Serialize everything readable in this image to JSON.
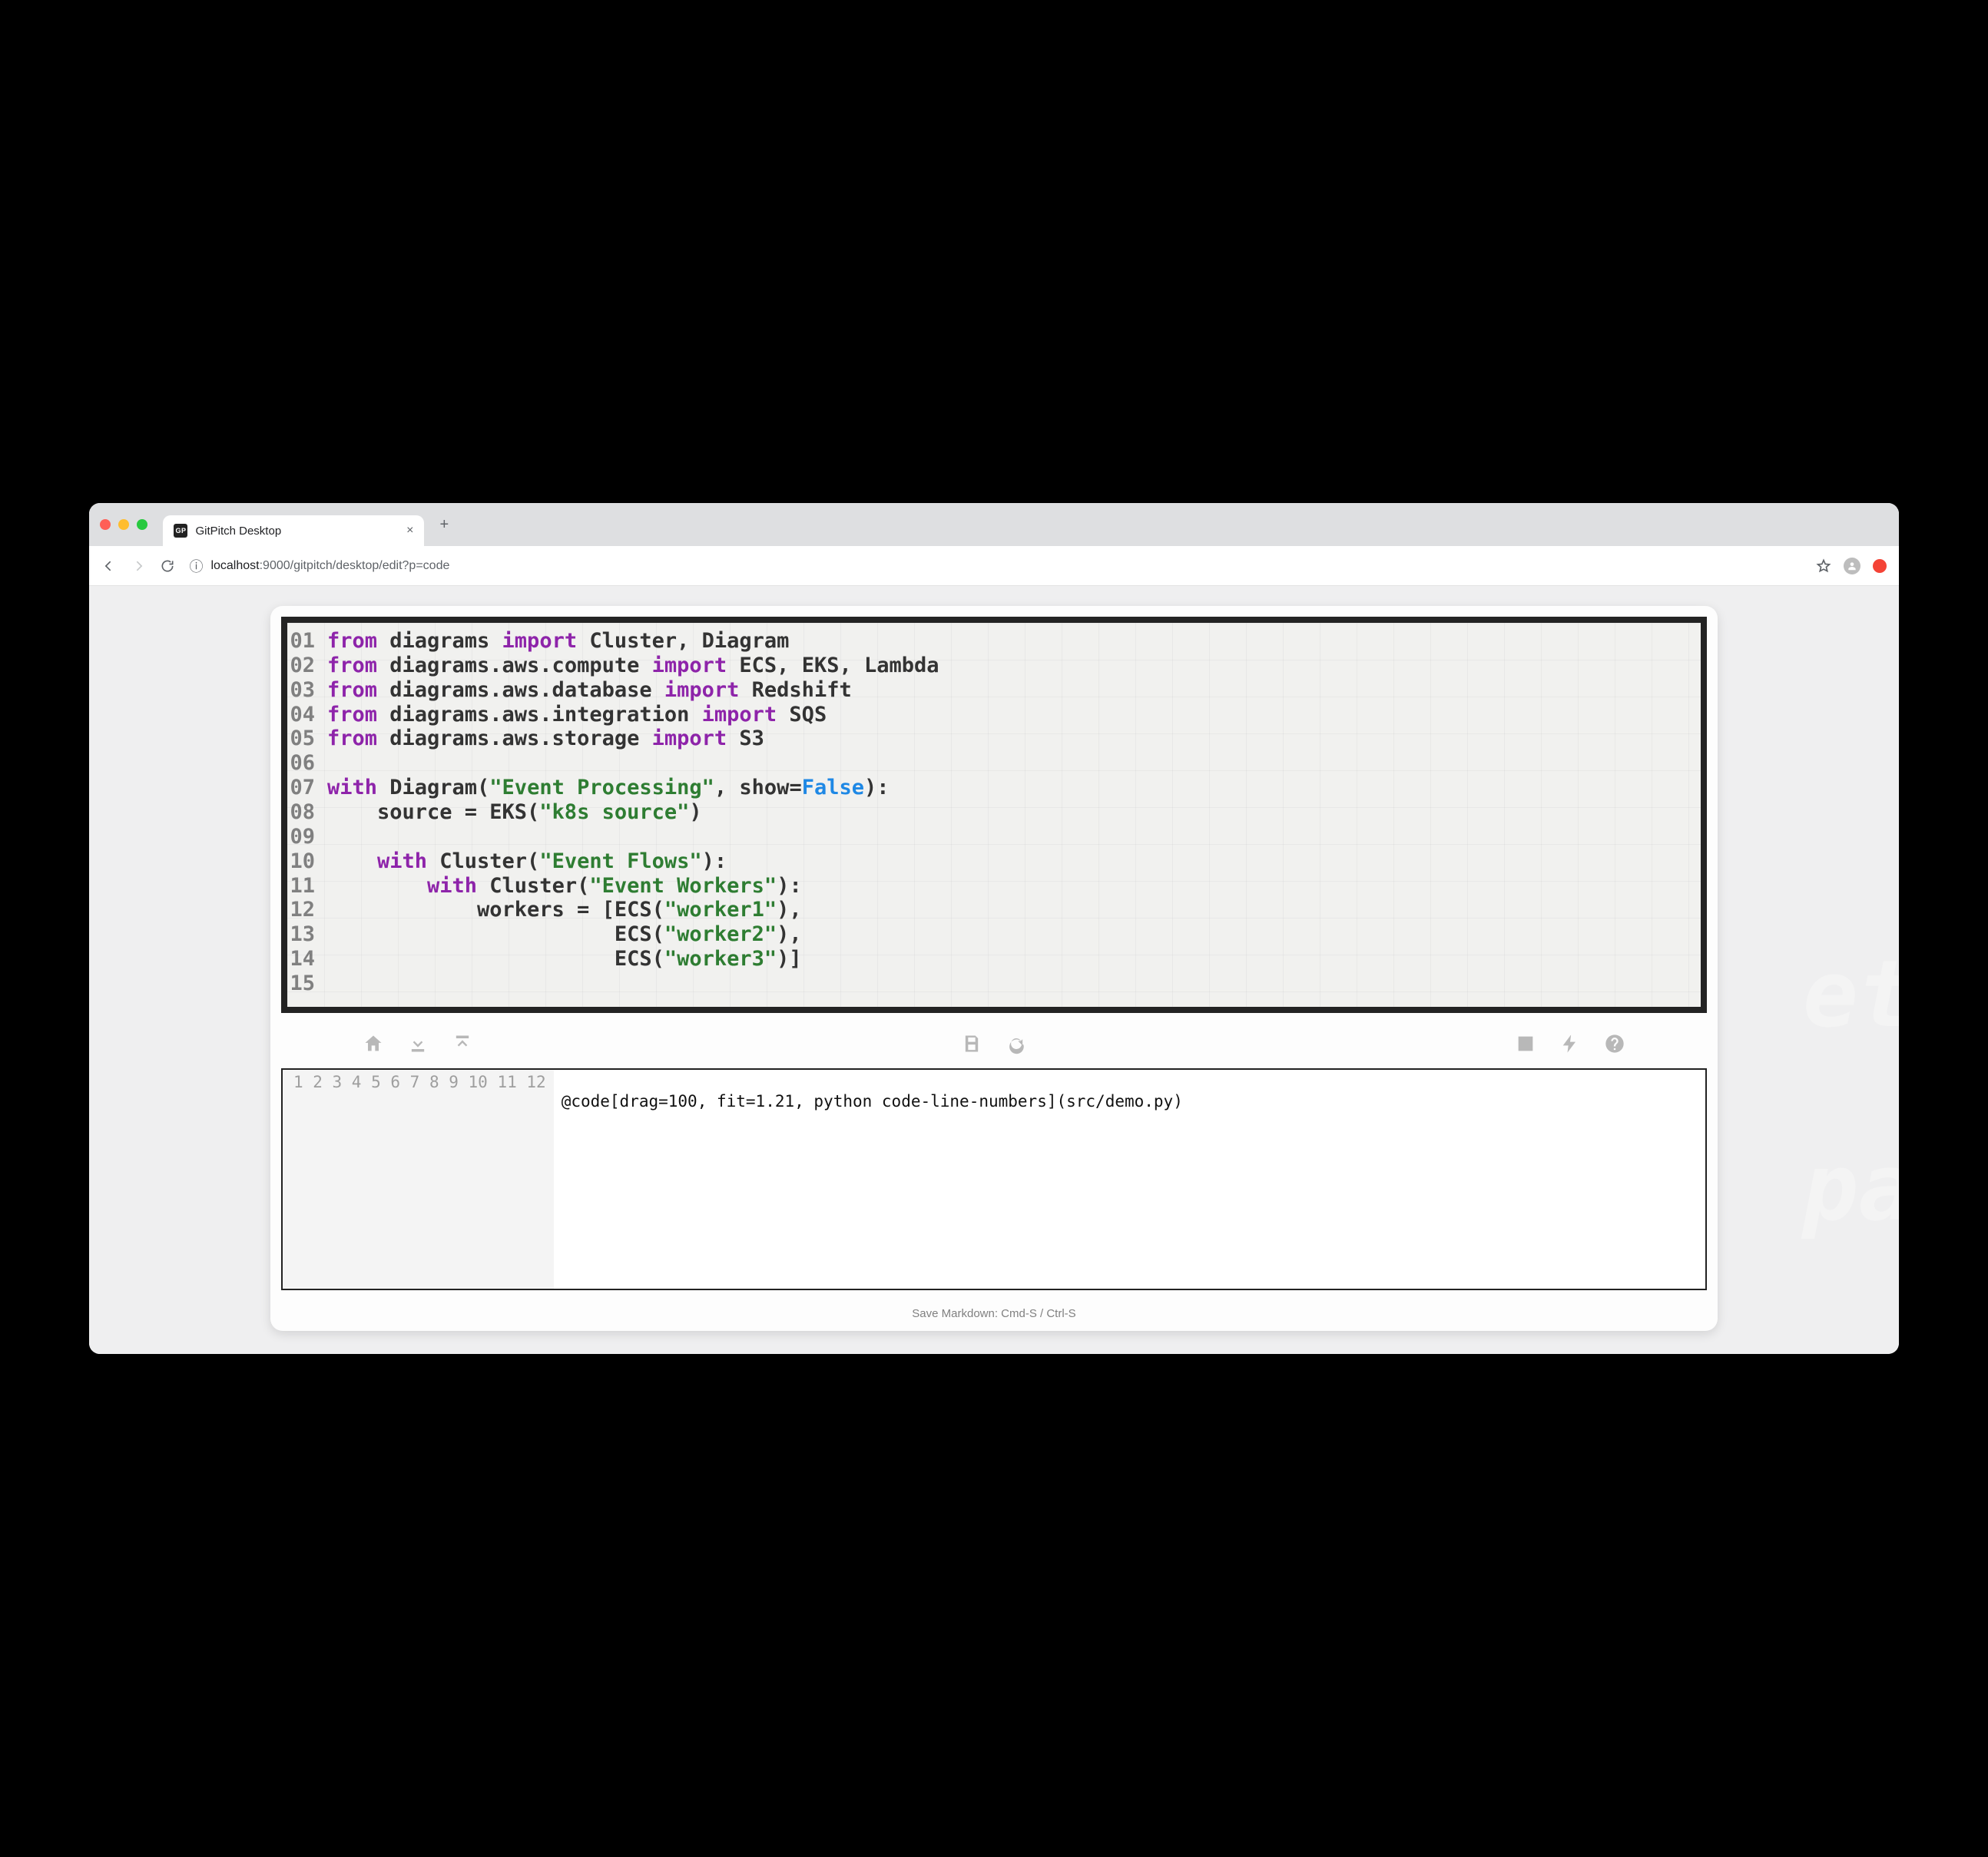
{
  "browser": {
    "tab_title": "GitPitch Desktop",
    "favicon_text": "GP",
    "close_glyph": "×",
    "newtab_glyph": "+"
  },
  "toolbar": {
    "url_host": "localhost",
    "url_port": ":9000",
    "url_path": "/gitpitch/desktop/edit?p=code",
    "info_glyph": "ⓘ"
  },
  "slide_code": {
    "lines": [
      {
        "n": "01",
        "tokens": [
          {
            "c": "kw",
            "t": "from"
          },
          {
            "c": "plain",
            "t": " diagrams "
          },
          {
            "c": "kw",
            "t": "import"
          },
          {
            "c": "plain",
            "t": " Cluster, Diagram"
          }
        ]
      },
      {
        "n": "02",
        "tokens": [
          {
            "c": "kw",
            "t": "from"
          },
          {
            "c": "plain",
            "t": " diagrams.aws.compute "
          },
          {
            "c": "kw",
            "t": "import"
          },
          {
            "c": "plain",
            "t": " ECS, EKS, Lambda"
          }
        ]
      },
      {
        "n": "03",
        "tokens": [
          {
            "c": "kw",
            "t": "from"
          },
          {
            "c": "plain",
            "t": " diagrams.aws.database "
          },
          {
            "c": "kw",
            "t": "import"
          },
          {
            "c": "plain",
            "t": " Redshift"
          }
        ]
      },
      {
        "n": "04",
        "tokens": [
          {
            "c": "kw",
            "t": "from"
          },
          {
            "c": "plain",
            "t": " diagrams.aws.integration "
          },
          {
            "c": "kw",
            "t": "import"
          },
          {
            "c": "plain",
            "t": " SQS"
          }
        ]
      },
      {
        "n": "05",
        "tokens": [
          {
            "c": "kw",
            "t": "from"
          },
          {
            "c": "plain",
            "t": " diagrams.aws.storage "
          },
          {
            "c": "kw",
            "t": "import"
          },
          {
            "c": "plain",
            "t": " S3"
          }
        ]
      },
      {
        "n": "06",
        "tokens": []
      },
      {
        "n": "07",
        "tokens": [
          {
            "c": "kw",
            "t": "with"
          },
          {
            "c": "plain",
            "t": " Diagram("
          },
          {
            "c": "str",
            "t": "\"Event Processing\""
          },
          {
            "c": "plain",
            "t": ", show="
          },
          {
            "c": "kw2",
            "t": "False"
          },
          {
            "c": "plain",
            "t": "):"
          }
        ]
      },
      {
        "n": "08",
        "tokens": [
          {
            "c": "plain",
            "t": "    source = EKS("
          },
          {
            "c": "str",
            "t": "\"k8s source\""
          },
          {
            "c": "plain",
            "t": ")"
          }
        ]
      },
      {
        "n": "09",
        "tokens": []
      },
      {
        "n": "10",
        "tokens": [
          {
            "c": "plain",
            "t": "    "
          },
          {
            "c": "kw",
            "t": "with"
          },
          {
            "c": "plain",
            "t": " Cluster("
          },
          {
            "c": "str",
            "t": "\"Event Flows\""
          },
          {
            "c": "plain",
            "t": "):"
          }
        ]
      },
      {
        "n": "11",
        "tokens": [
          {
            "c": "plain",
            "t": "        "
          },
          {
            "c": "kw",
            "t": "with"
          },
          {
            "c": "plain",
            "t": " Cluster("
          },
          {
            "c": "str",
            "t": "\"Event Workers\""
          },
          {
            "c": "plain",
            "t": "):"
          }
        ]
      },
      {
        "n": "12",
        "tokens": [
          {
            "c": "plain",
            "t": "            workers = [ECS("
          },
          {
            "c": "str",
            "t": "\"worker1\""
          },
          {
            "c": "plain",
            "t": "),"
          }
        ]
      },
      {
        "n": "13",
        "tokens": [
          {
            "c": "plain",
            "t": "                       ECS("
          },
          {
            "c": "str",
            "t": "\"worker2\""
          },
          {
            "c": "plain",
            "t": "),"
          }
        ]
      },
      {
        "n": "14",
        "tokens": [
          {
            "c": "plain",
            "t": "                       ECS("
          },
          {
            "c": "str",
            "t": "\"worker3\""
          },
          {
            "c": "plain",
            "t": ")]"
          }
        ]
      },
      {
        "n": "15",
        "tokens": []
      }
    ]
  },
  "editor": {
    "line_count": 12,
    "lines": [
      "",
      "@code[drag=100, fit=1.21, python code-line-numbers](src/demo.py)",
      "",
      "",
      "",
      "",
      "",
      "",
      "",
      "",
      "",
      ""
    ]
  },
  "statusbar": {
    "text": "Save Markdown: Cmd-S / Ctrl-S"
  },
  "bg_hints": "et\n\n pa\n\nar\n\nd("
}
